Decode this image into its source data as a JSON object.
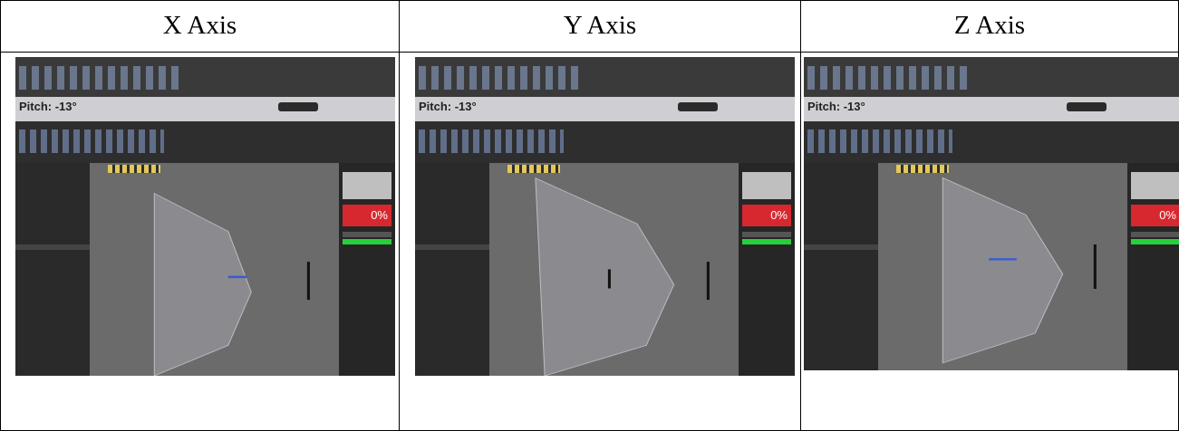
{
  "headers": [
    "X Axis",
    "Y Axis",
    "Z Axis"
  ],
  "screenshots": [
    {
      "info_label": "Pitch: -13°",
      "percent": "0%"
    },
    {
      "info_label": "Pitch: -13°",
      "percent": "0%"
    },
    {
      "info_label": "Pitch: -13°",
      "percent": "0%"
    }
  ],
  "colors": {
    "grid": "#000000",
    "accent_red": "#d8282f",
    "accent_green": "#25d13a"
  }
}
